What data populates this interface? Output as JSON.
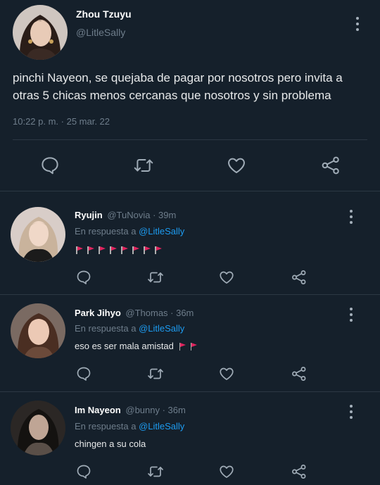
{
  "main_tweet": {
    "author_name": "Zhou Tzuyu",
    "handle": "@LitleSally",
    "text_line1": "pinchi Nayeon, se quejaba de pagar por nosotros pero invita a",
    "text_line2": "otras 5 chicas menos cercanas que nosotros y sin problema",
    "timestamp": "10:22 p. m. · 25 mar. 22"
  },
  "replies": [
    {
      "name": "Ryujin",
      "handle": "@TuNovia · 39m",
      "reply_prefix": "En respuesta a",
      "reply_to": "@LitleSally",
      "text": "",
      "flag_count": 8
    },
    {
      "name": "Park Jihyo",
      "handle": "@Thomas · 36m",
      "reply_prefix": "En respuesta a",
      "reply_to": "@LitleSally",
      "text": "eso es ser mala amistad",
      "flag_count": 2
    },
    {
      "name": "Im Nayeon",
      "handle": "@bunny · 36m",
      "reply_prefix": "En respuesta a",
      "reply_to": "@LitleSally",
      "text": "chingen a su cola",
      "flag_count": 0
    }
  ],
  "icons": {
    "reply": "comment-bubble-icon",
    "retweet": "retweet-icon",
    "like": "heart-icon",
    "share": "share-icon",
    "more": "kebab-menu-icon",
    "flag": "triangular-red-flag"
  },
  "colors": {
    "background": "#15202b",
    "link": "#1d9bf0",
    "flag": "#e0245e"
  }
}
